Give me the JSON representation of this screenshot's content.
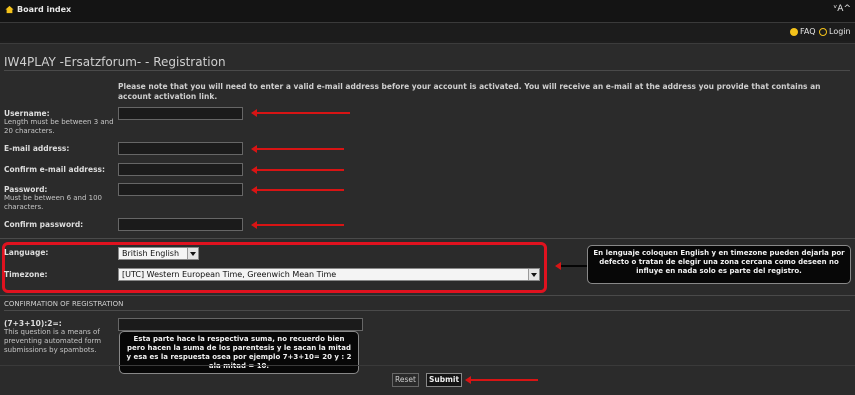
{
  "header": {
    "board_index": "Board index",
    "font_size_control": "ᵛA^",
    "faq": "FAQ",
    "login": "Login"
  },
  "page": {
    "title": "IW4PLAY -Ersatzforum- - Registration",
    "note": "Please note that you will need to enter a valid e-mail address before your account is activated. You will receive an e-mail at the address you provide that contains an account activation link."
  },
  "form": {
    "username_label": "Username:",
    "username_hint": "Length must be between 3 and 20 characters.",
    "email_label": "E-mail address:",
    "confirm_email_label": "Confirm e-mail address:",
    "password_label": "Password:",
    "password_hint": "Must be between 6 and 100 characters.",
    "confirm_password_label": "Confirm password:",
    "language_label": "Language:",
    "language_value": "British English",
    "timezone_label": "Timezone:",
    "timezone_value": "[UTC] Western European Time, Greenwich Mean Time"
  },
  "confirmation": {
    "section_title": "CONFIRMATION OF REGISTRATION",
    "question": "(7+3+10):2=:",
    "hint": "This question is a means of preventing automated form submissions by spambots."
  },
  "buttons": {
    "reset": "Reset",
    "submit": "Submit"
  },
  "annotations": {
    "language_callout": "En lenguaje coloquen English y en timezone pueden dejarla por defecto o tratan de elegir una zona cercana como deseen no influye en nada solo es parte del registro.",
    "captcha_callout": "Esta parte hace la respectiva suma, no recuerdo bien pero hacen la suma de los parentesis y le sacan la mitad y esa es la respuesta osea por ejemplo 7+3+10= 20 y : 2 ala mitad = 10."
  },
  "colors": {
    "accent_red": "#e0121f",
    "arrow_red": "#d81414",
    "background": "#2b2b2b",
    "topbar": "#141414"
  },
  "icons": {
    "home": "home-icon",
    "faq": "help-icon",
    "login": "power-icon"
  }
}
